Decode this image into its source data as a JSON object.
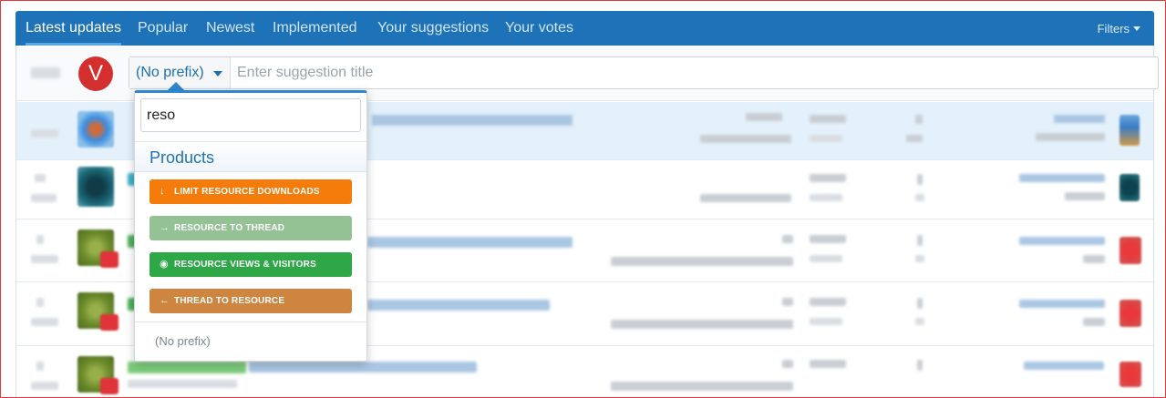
{
  "tabs": [
    {
      "label": "Latest updates",
      "active": true
    },
    {
      "label": "Popular",
      "active": false
    },
    {
      "label": "Newest",
      "active": false
    },
    {
      "label": "Implemented",
      "active": false
    },
    {
      "label": "Your suggestions",
      "active": false
    },
    {
      "label": "Your votes",
      "active": false
    }
  ],
  "filters_label": "Filters",
  "new_suggestion": {
    "avatar_letter": "V",
    "prefix_value": "(No prefix)",
    "title_placeholder": "Enter suggestion title"
  },
  "prefix_dropdown": {
    "search_value": "reso",
    "group_title": "Products",
    "options": [
      {
        "label": "LIMIT RESOURCE DOWNLOADS",
        "icon": "↓",
        "color": "#f57c0a"
      },
      {
        "label": "RESOURCE TO THREAD",
        "icon": "→",
        "color": "#94c295"
      },
      {
        "label": "RESOURCE VIEWS & VISITORS",
        "icon": "◉",
        "color": "#2ea846"
      },
      {
        "label": "THREAD TO RESOURCE",
        "icon": "←",
        "color": "#cd8540"
      }
    ],
    "no_prefix_label": "(No prefix)"
  },
  "colors": {
    "tab_bar": "#1e72b8",
    "accent": "#2f86cf",
    "avatar_bg": "#d32f2f",
    "row_highlight": "#e4f1fb"
  }
}
